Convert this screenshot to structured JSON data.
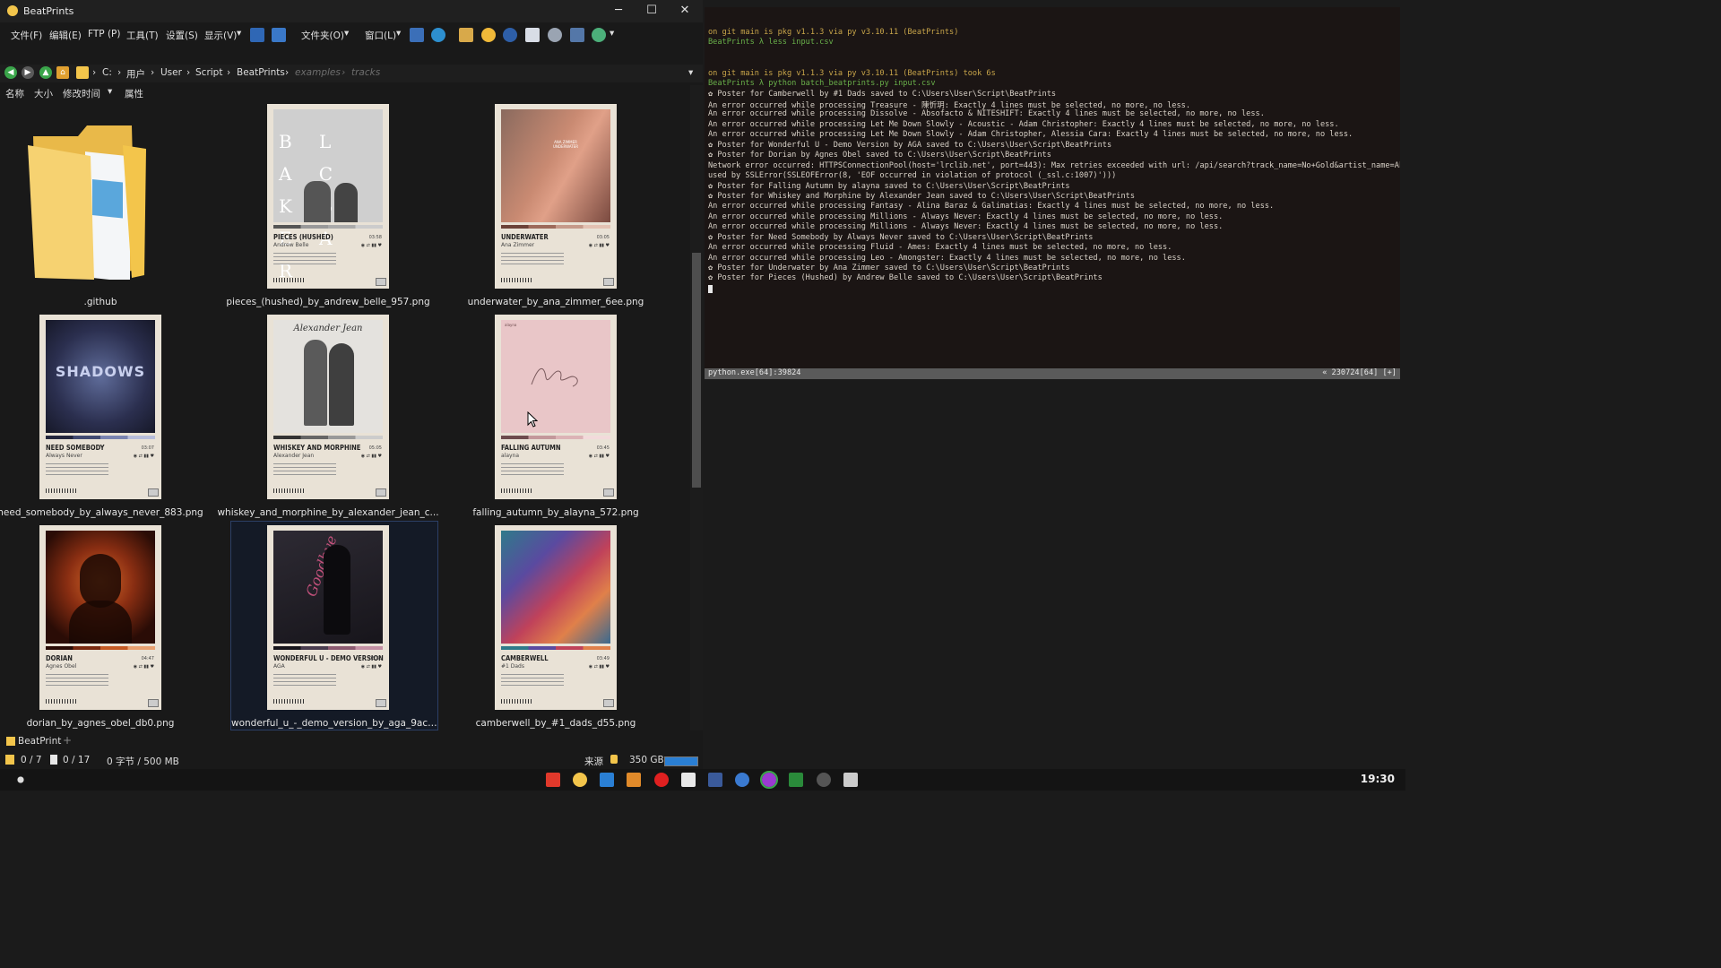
{
  "window": {
    "title": "BeatPrints"
  },
  "menu": [
    "文件(F)",
    "编辑(E)",
    "FTP (P)",
    "工具(T)",
    "设置(S)",
    "显示(V)",
    "文件夹(O)",
    "窗口(L)"
  ],
  "breadcrumb": [
    "C:",
    "用户",
    "User",
    "Script",
    "BeatPrints",
    "examples",
    "tracks"
  ],
  "columns": [
    "名称",
    "大小",
    "修改时间",
    "属性"
  ],
  "files": [
    {
      "name": ".github",
      "kind": "folder"
    },
    {
      "name": "pieces_(hushed)_by_andrew_belle_957.png",
      "song": "PIECES (HUSHED)",
      "artist": "Andrew Belle",
      "duration": "03:58",
      "art_text": "B L A C K B E A R"
    },
    {
      "name": "underwater_by_ana_zimmer_6ee.png",
      "song": "UNDERWATER",
      "artist": "Ana Zimmer",
      "duration": "03:05",
      "art_text": "ANA ZIMMER UNDERWATER"
    },
    {
      "name": "need_somebody_by_always_never_883.png",
      "song": "NEED SOMEBODY",
      "artist": "Always Never",
      "duration": "03:07",
      "art_text": "SHADOWS"
    },
    {
      "name": "whiskey_and_morphine_by_alexander_jean_c...",
      "song": "WHISKEY AND MORPHINE",
      "artist": "Alexander Jean",
      "duration": "05:05",
      "art_text": "Alexander Jean"
    },
    {
      "name": "falling_autumn_by_alayna_572.png",
      "song": "FALLING AUTUMN",
      "artist": "alayna",
      "duration": "03:45",
      "art_text": "alayna"
    },
    {
      "name": "dorian_by_agnes_obel_db0.png",
      "song": "DORIAN",
      "artist": "Agnes Obel",
      "duration": "04:47"
    },
    {
      "name": "wonderful_u_-_demo_version_by_aga_9ac.png",
      "song": "WONDERFUL U - DEMO VERSION",
      "artist": "AGA",
      "duration": "03:33",
      "art_text": "Goodbye"
    },
    {
      "name": "camberwell_by_#1_dads_d55.png",
      "song": "CAMBERWELL",
      "artist": "#1 Dads",
      "duration": "03:49"
    }
  ],
  "tab": {
    "label": "BeatPrint"
  },
  "status": {
    "dirs": "0 / 7",
    "files": "0 / 17",
    "size": "0 字节 / 500 MB",
    "source": "来源",
    "free": "350 GB"
  },
  "terminal": {
    "lines": [
      {
        "prompt": "on git main is pkg v1.1.3 via py v3.10.11 (BeatPrints)"
      },
      {
        "cmd": "BeatPrints λ less input.csv"
      },
      {
        "prompt": "on git main is pkg v1.1.3 via py v3.10.11 (BeatPrints) took 6s"
      },
      {
        "cmd": "BeatPrints λ python batch_beatprints.py input.csv"
      },
      {
        "text": "✿ Poster for Camberwell by #1 Dads saved to C:\\Users\\User\\Script\\BeatPrints"
      },
      {
        "text": "An error occurred while processing Treasure - 陳忻玥: Exactly 4 lines must be selected, no more, no less."
      },
      {
        "text": "An error occurred while processing Dissolve - Absofacto & NITESHIFT: Exactly 4 lines must be selected, no more, no less."
      },
      {
        "text": "An error occurred while processing Let Me Down Slowly - Acoustic - Adam Christopher: Exactly 4 lines must be selected, no more, no less."
      },
      {
        "text": "An error occurred while processing Let Me Down Slowly - Adam Christopher, Alessia Cara: Exactly 4 lines must be selected, no more, no less."
      },
      {
        "text": "✿ Poster for Wonderful U - Demo Version by AGA saved to C:\\Users\\User\\Script\\BeatPrints"
      },
      {
        "text": "✿ Poster for Dorian by Agnes Obel saved to C:\\Users\\User\\Script\\BeatPrints"
      },
      {
        "text": "Network error occurred: HTTPSConnectionPool(host='lrclib.net', port=443): Max retries exceeded with url: /api/search?track_name=No+Gold&artist_name=Akine (Ca"
      },
      {
        "text": "used by SSLError(SSLEOFError(8, 'EOF occurred in violation of protocol (_ssl.c:1007)')))"
      },
      {
        "text": "✿ Poster for Falling Autumn by alayna saved to C:\\Users\\User\\Script\\BeatPrints"
      },
      {
        "text": "✿ Poster for Whiskey and Morphine by Alexander Jean saved to C:\\Users\\User\\Script\\BeatPrints"
      },
      {
        "text": "An error occurred while processing Fantasy - Alina Baraz & Galimatias: Exactly 4 lines must be selected, no more, no less."
      },
      {
        "text": "An error occurred while processing Millions - Always Never: Exactly 4 lines must be selected, no more, no less."
      },
      {
        "text": "An error occurred while processing Millions - Always Never: Exactly 4 lines must be selected, no more, no less."
      },
      {
        "text": "✿ Poster for Need Somebody by Always Never saved to C:\\Users\\User\\Script\\BeatPrints"
      },
      {
        "text": "An error occurred while processing Fluid - Ames: Exactly 4 lines must be selected, no more, no less."
      },
      {
        "text": "An error occurred while processing Leo - Amongster: Exactly 4 lines must be selected, no more, no less."
      },
      {
        "text": "✿ Poster for Underwater by Ana Zimmer saved to C:\\Users\\User\\Script\\BeatPrints"
      },
      {
        "text": "✿ Poster for Pieces (Hushed) by Andrew Belle saved to C:\\Users\\User\\Script\\BeatPrints"
      }
    ],
    "status_left": "python.exe[64]:39824",
    "status_right": "« 230724[64] [+]"
  },
  "clock": "19:30",
  "colors": {
    "accent": "#2a7fd4",
    "terminal_prompt": "#c9a64a",
    "terminal_git": "#69b04a"
  }
}
